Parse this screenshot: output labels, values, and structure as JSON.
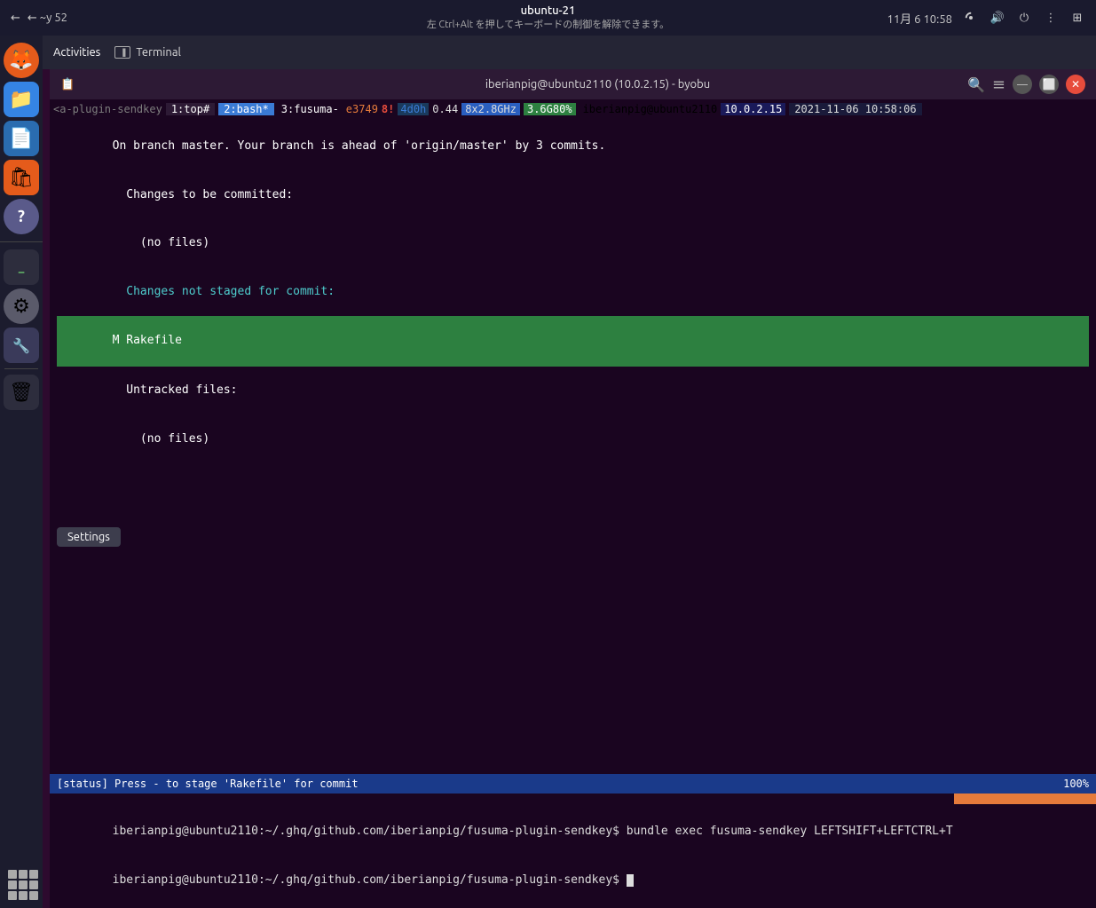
{
  "systemBar": {
    "leftText": "← ~y 52",
    "windowTitle": "ubuntu-21",
    "captureHint": "左 Ctrl+Alt を押してキーボードの制御を解除できます。",
    "dateTime": "11月 6  10:58"
  },
  "navBar": {
    "activities": "Activities",
    "terminal": "Terminal"
  },
  "terminalTitlebar": {
    "title": "iberianpig@ubuntu2110 (10.0.2.15) - byobu"
  },
  "byobuTop": {
    "plugin": "<a-plugin-sendkey",
    "pane": "1:top#",
    "bash": "2:bash*",
    "fusuma": "3:fusuma-",
    "e3749": "e3749",
    "excl": "8!",
    "uptime": "4d0h",
    "load": "0.44",
    "cpu": "8x2.8GHz",
    "mem": "3.6G80%",
    "hostname": "iberianpig@ubuntu2110",
    "ip": "10.0.2.15",
    "datetime": "2021-11-06 10:58:06"
  },
  "terminalContent": {
    "line1": "On branch master. Your branch is ahead of 'origin/master' by 3 commits.",
    "line2": "  Changes to be committed:",
    "line3": "    (no files)",
    "line4": "  Changes not staged for commit:",
    "line5_highlight": "M Rakefile",
    "line6": "  Untracked files:",
    "line7": "    (no files)"
  },
  "statusBar": {
    "text": "[status] Press - to stage 'Rakefile' for commit",
    "percent": "100%"
  },
  "commands": {
    "cmd1": "iberianpig@ubuntu2110:~/.ghq/github.com/iberianpig/fusuma-plugin-sendkey$ bundle exec fusuma-sendkey LEFTSHIFT+LEFTCTRL+T",
    "cmd2": "iberianpig@ubuntu2110:~/.ghq/github.com/iberianpig/fusuma-plugin-sendkey$ "
  },
  "dock": {
    "items": [
      {
        "name": "Firefox",
        "icon": "🦊"
      },
      {
        "name": "Files",
        "icon": "📁"
      },
      {
        "name": "Writer",
        "icon": "📝"
      },
      {
        "name": "Software",
        "icon": "🛍"
      },
      {
        "name": "Help",
        "icon": "?"
      },
      {
        "name": "Terminal",
        "icon": ">_"
      },
      {
        "name": "Settings",
        "icon": "⚙"
      },
      {
        "name": "Tweaks",
        "icon": "🔧"
      },
      {
        "name": "Trash",
        "icon": "🗑"
      }
    ]
  },
  "settings": {
    "tooltipLabel": "Settings"
  }
}
